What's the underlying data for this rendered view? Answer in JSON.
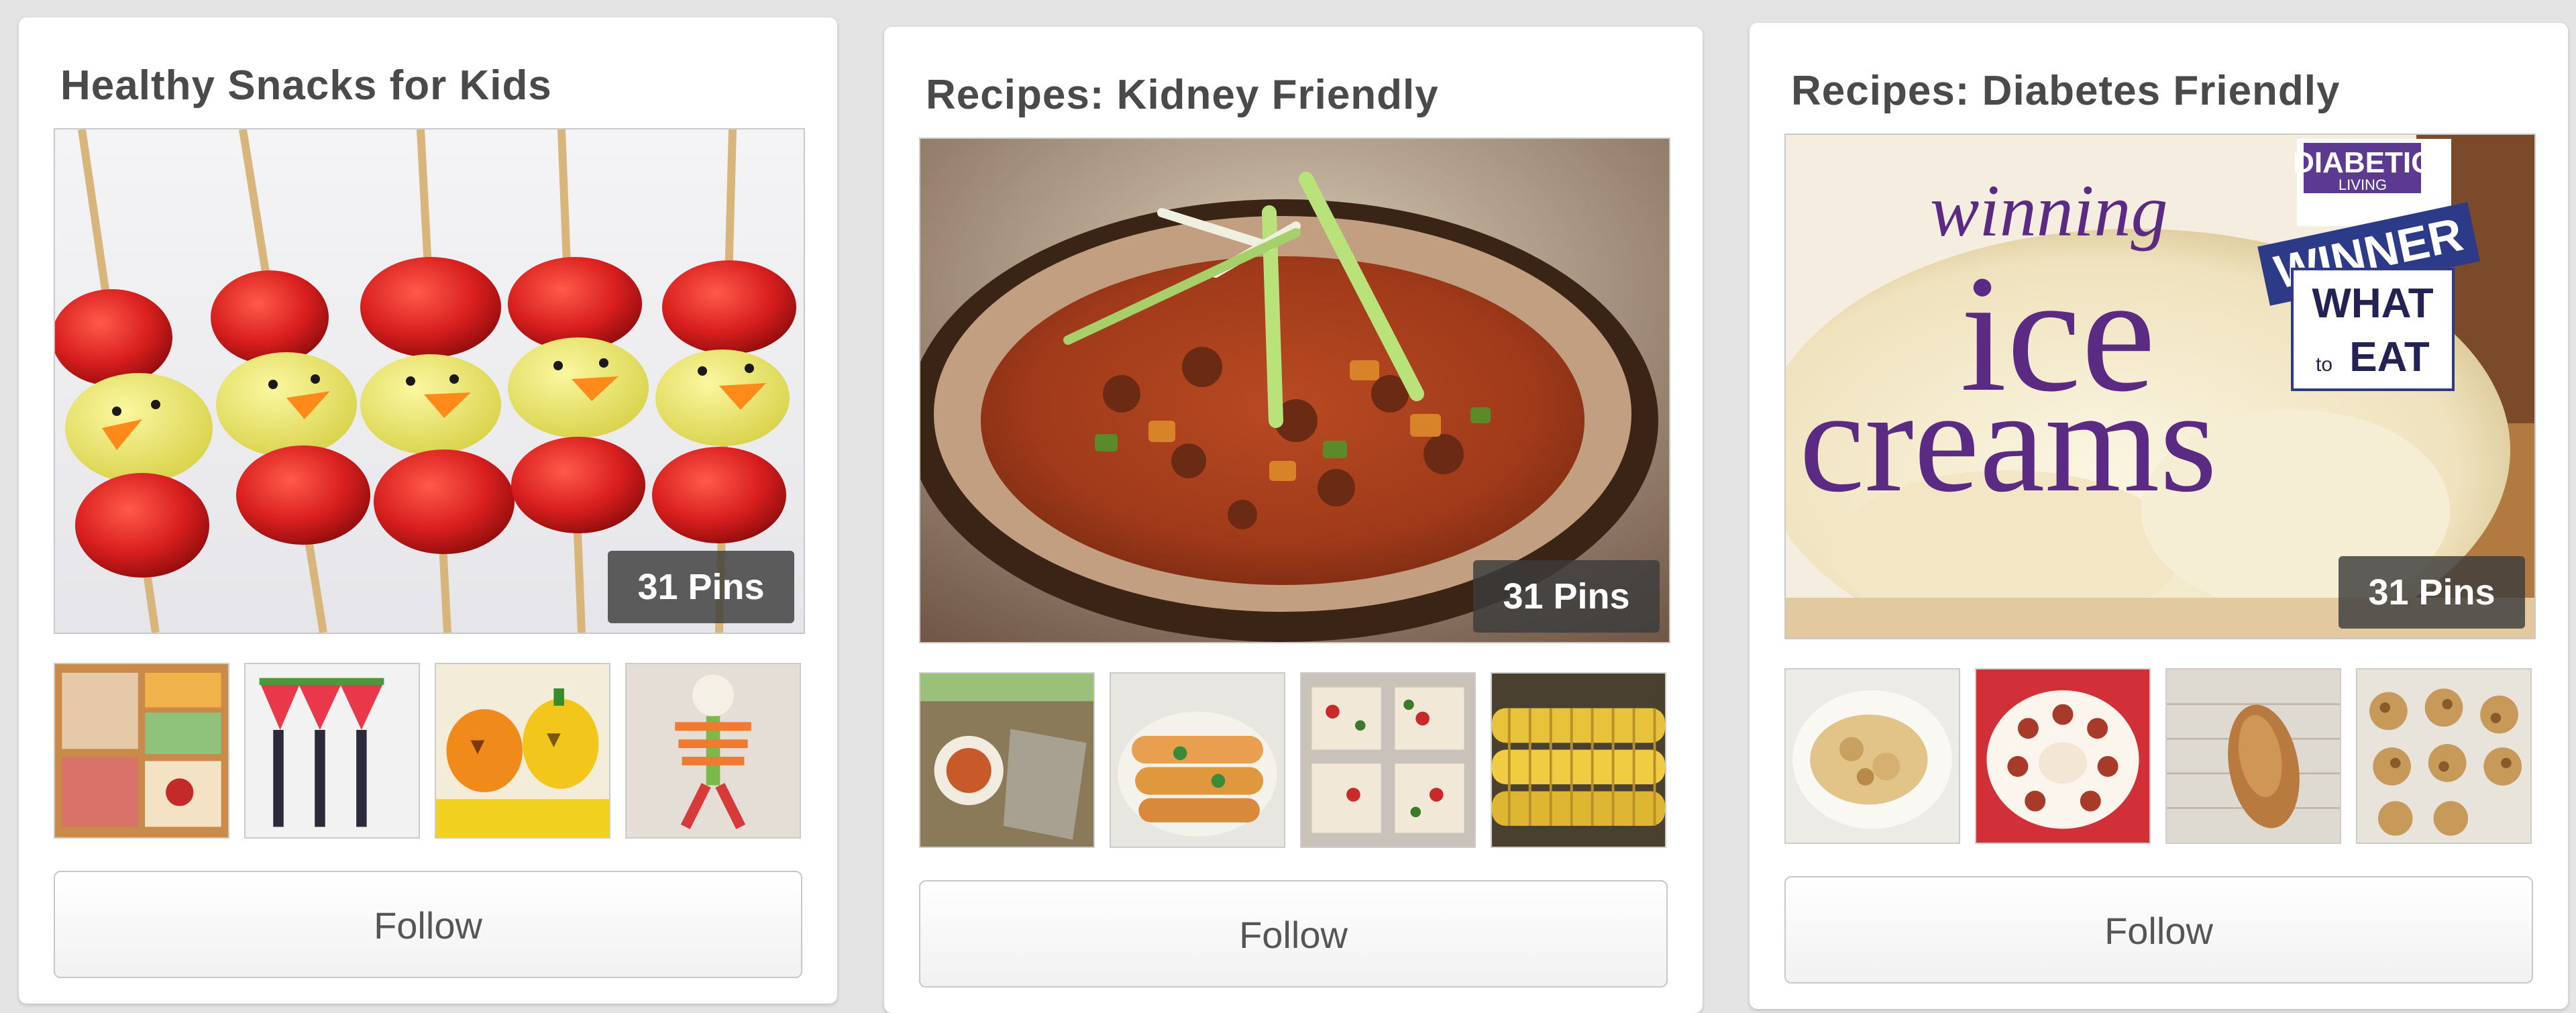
{
  "boards": [
    {
      "title": "Healthy Snacks for Kids",
      "pins_label": "31 Pins",
      "follow_label": "Follow",
      "cover_icon": "chick-skewers-photo",
      "thumbnails": [
        "bento-lunch-photo",
        "watermelon-pops-photo",
        "pumpkin-fruit-photo",
        "veggie-skeleton-photo"
      ]
    },
    {
      "title": "Recipes: Kidney Friendly",
      "pins_label": "31 Pins",
      "follow_label": "Follow",
      "cover_icon": "chili-bowl-photo",
      "thumbnails": [
        "dip-and-crackers-photo",
        "enchiladas-photo",
        "pizza-squares-photo",
        "corn-cobs-photo"
      ]
    },
    {
      "title": "Recipes: Diabetes Friendly",
      "pins_label": "31 Pins",
      "follow_label": "Follow",
      "cover_icon": "ice-cream-photo",
      "cover_text": {
        "line1": "winning",
        "line2": "ice",
        "line3": "creams",
        "badge_brand": "DIABETIC",
        "badge_sub": "LIVING",
        "badge_winner": "WINNER",
        "badge_what": "WHAT",
        "badge_to": "to",
        "badge_eat": "EAT"
      },
      "thumbnails": [
        "casserole-photo",
        "cake-slice-photo",
        "bread-loaf-photo",
        "cookies-photo"
      ]
    }
  ],
  "colors": {
    "page_background": "#e4e4e4",
    "card_background": "#ffffff",
    "title_text": "#4a4a4a",
    "ice_cream_purple": "#5b2a82"
  }
}
